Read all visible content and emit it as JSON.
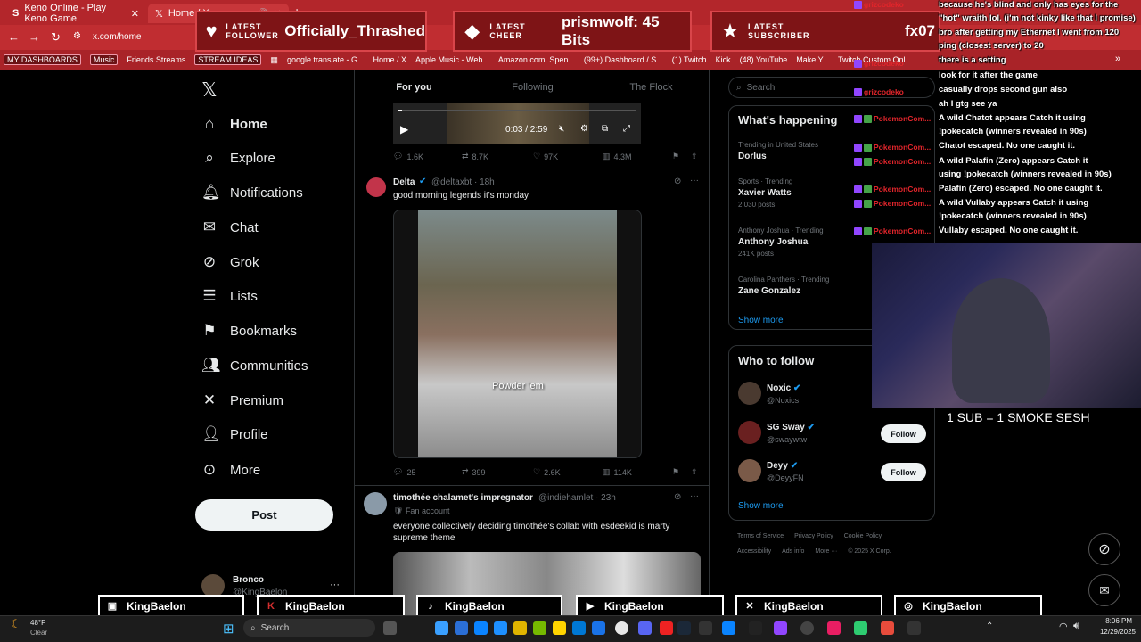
{
  "browser": {
    "tabs": [
      {
        "title": "Keno Online - Play Keno Game",
        "icon": "s-favicon"
      },
      {
        "title": "Home / X",
        "icon": "x-favicon"
      }
    ],
    "url": "x.com/home",
    "bookmarks": [
      "MY DASHBOARDS",
      "Music",
      "Friends Streams",
      "STREAM IDEAS",
      "google translate - G...",
      "Home / X",
      "Apple Music - Web...",
      "Amazon.com. Spen...",
      "(99+) Dashboard / S...",
      "(1) Twitch",
      "Kick",
      "(48) YouTube",
      "Make Y...",
      "Twitch Custom Onl..."
    ]
  },
  "alerts": [
    {
      "label1": "LATEST",
      "label2": "FOLLOWER",
      "value": "Officially_Thrashed",
      "icon": "heart-icon"
    },
    {
      "label1": "LATEST",
      "label2": "CHEER",
      "value": "prismwolf: 45 Bits",
      "icon": "diamond-icon"
    },
    {
      "label1": "LATEST",
      "label2": "SUBSCRIBER",
      "value": "fx07",
      "icon": "star-icon"
    }
  ],
  "nav": {
    "items": [
      {
        "label": "Home",
        "icon": "home-icon"
      },
      {
        "label": "Explore",
        "icon": "search-icon"
      },
      {
        "label": "Notifications",
        "icon": "bell-icon"
      },
      {
        "label": "Chat",
        "icon": "mail-icon"
      },
      {
        "label": "Grok",
        "icon": "grok-icon"
      },
      {
        "label": "Lists",
        "icon": "list-icon"
      },
      {
        "label": "Bookmarks",
        "icon": "bookmark-icon"
      },
      {
        "label": "Communities",
        "icon": "people-icon"
      },
      {
        "label": "Premium",
        "icon": "x-icon"
      },
      {
        "label": "Profile",
        "icon": "person-icon"
      },
      {
        "label": "More",
        "icon": "more-icon"
      }
    ],
    "post_label": "Post",
    "account_name": "Bronco",
    "account_handle": "@KingBaelon"
  },
  "feed": {
    "tabs": [
      "For you",
      "Following",
      "The Flock"
    ],
    "video_time": "0:03 / 2:59",
    "post0_stats": {
      "replies": "1.6K",
      "reposts": "8.7K",
      "likes": "97K",
      "views": "4.3M"
    },
    "post1": {
      "name": "Delta",
      "handle": "@deltaxbt · 18h",
      "text": "good morning legends it's monday",
      "caption": "Powder 'em",
      "stats": {
        "replies": "25",
        "reposts": "399",
        "likes": "2.6K",
        "views": "114K"
      }
    },
    "post2": {
      "name": "timothée chalamet's impregnator",
      "handle": "@indiehamlet · 23h",
      "sub": "Fan account",
      "text": "everyone collectively deciding timothée's collab with esdeekid is marty supreme theme"
    }
  },
  "right": {
    "search_placeholder": "Search",
    "happening_title": "What's happening",
    "trends": [
      {
        "meta": "Trending in United States",
        "name": "Dorlus",
        "count": ""
      },
      {
        "meta": "Sports · Trending",
        "name": "Xavier Watts",
        "count": "2,030 posts"
      },
      {
        "meta": "Anthony Joshua · Trending",
        "name": "Anthony Joshua",
        "count": "241K posts"
      },
      {
        "meta": "Carolina Panthers · Trending",
        "name": "Zane Gonzalez",
        "count": ""
      }
    ],
    "show_more": "Show more",
    "who_title": "Who to follow",
    "who": [
      {
        "name": "Noxic",
        "handle": "@Noxics"
      },
      {
        "name": "SG Sway",
        "handle": "@swaywtw"
      },
      {
        "name": "Deyy",
        "handle": "@DeyyFN"
      }
    ],
    "follow_label": "Follow",
    "footer_line1": [
      "Terms of Service",
      "Privacy Policy",
      "Cookie Policy"
    ],
    "footer_line2": [
      "Accessibility",
      "Ads info",
      "More ···",
      "© 2025 X Corp."
    ]
  },
  "chat": {
    "lines": [
      "because he's blind and only has eyes for the",
      "\"hot\" wraith lol. (i'm not kinky like that I promise)",
      "bro after getting my Ethernet I went from 120",
      "ping (closest server) to 20",
      "there is a setting",
      "look for it after the game",
      "casually drops second gun also",
      "ah I gtg see ya",
      "A wild Chatot appears    Catch it using",
      "!pokecatch (winners revealed in 90s)",
      "Chatot escaped. No one caught it.",
      "A wild Palafin (Zero) appears    Catch it",
      "using !pokecatch (winners revealed in 90s)",
      "Palafin (Zero) escaped. No one caught it.",
      "A wild Vullaby appears    Catch it using",
      "!pokecatch (winners revealed in 90s)",
      "Vullaby escaped. No one caught it."
    ],
    "names": [
      "grizcodeko",
      "grizcodeko",
      "grizcodeko",
      "PokemonCom...",
      "PokemonCom...",
      "PokemonCom...",
      "PokemonCom...",
      "PokemonCom...",
      "PokemonCom..."
    ]
  },
  "stream": {
    "webcam_caption": "1 SUB = 1 SMOKE SESH",
    "socials": [
      {
        "platform": "twitch",
        "handle": "KingBaelon"
      },
      {
        "platform": "kick",
        "handle": "KingBaelon"
      },
      {
        "platform": "tiktok",
        "handle": "KingBaelon"
      },
      {
        "platform": "youtube",
        "handle": "KingBaelon"
      },
      {
        "platform": "x",
        "handle": "KingBaelon"
      },
      {
        "platform": "instagram",
        "handle": "KingBaelon"
      }
    ]
  },
  "taskbar": {
    "weather_temp": "48°F",
    "weather_desc": "Clear",
    "search_label": "Search",
    "time": "8:06 PM",
    "date": "12/29/2025"
  }
}
